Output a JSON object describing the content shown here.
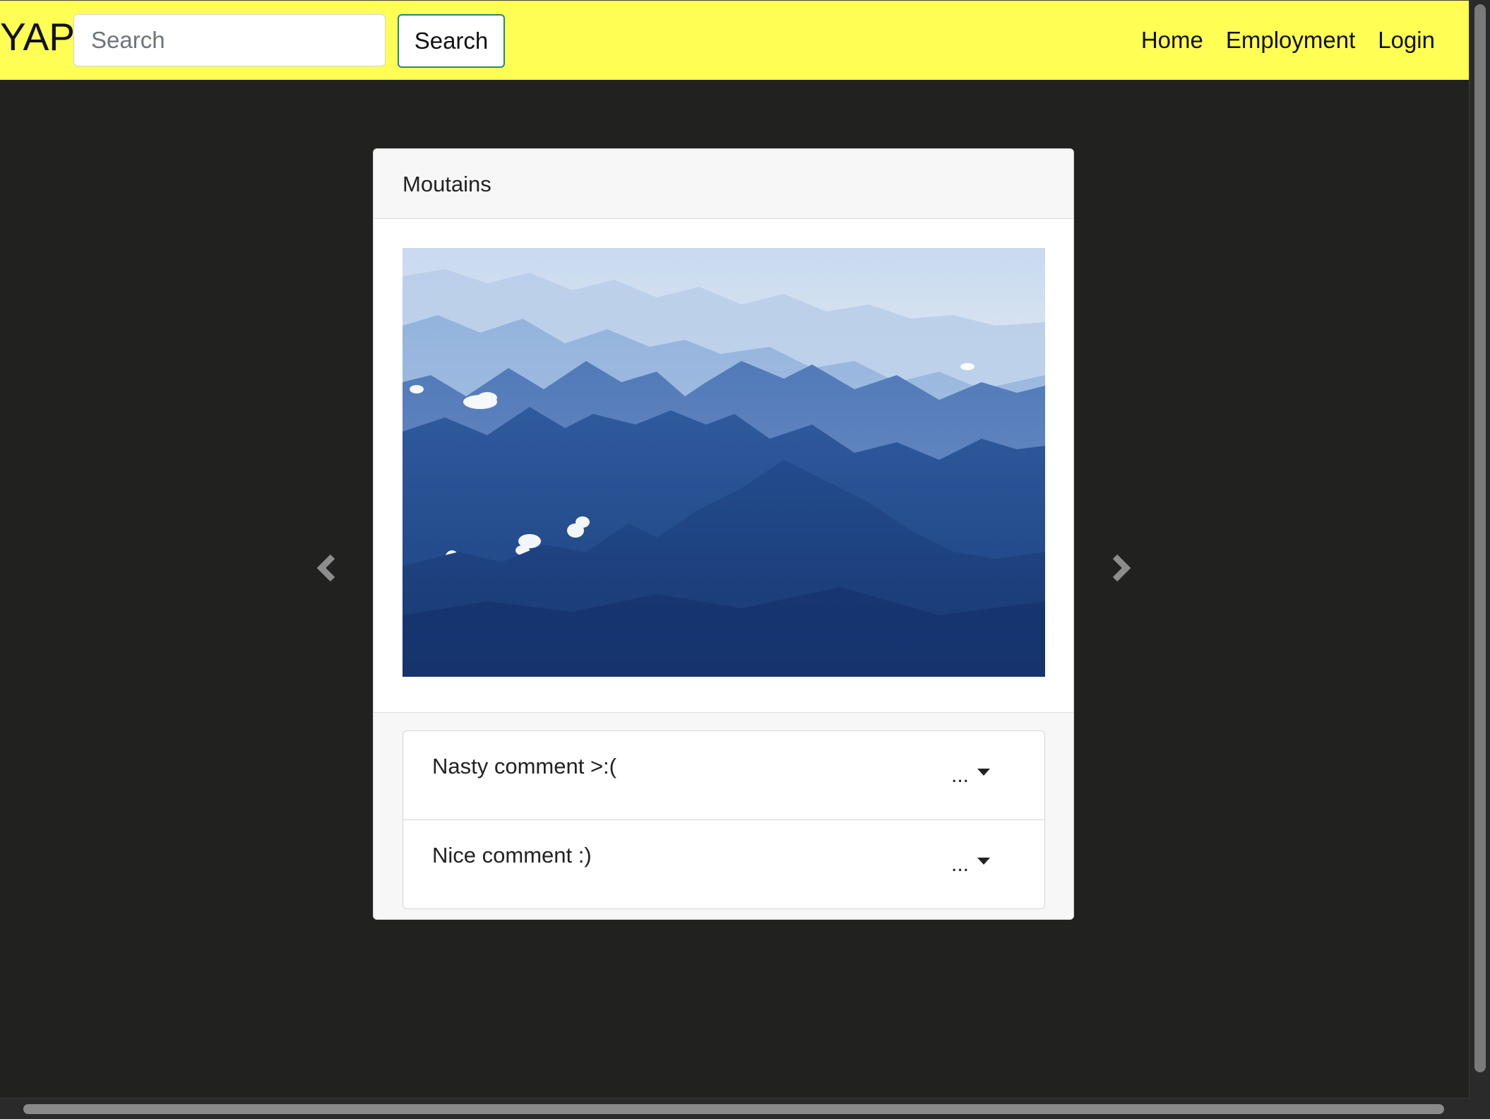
{
  "navbar": {
    "brand": "YAP",
    "search_placeholder": "Search",
    "search_button": "Search",
    "links": [
      "Home",
      "Employment",
      "Login"
    ],
    "background_color": "#fffe55"
  },
  "post": {
    "title": "Moutains",
    "image_icon": "mountain-landscape-image",
    "comments": [
      {
        "text": "Nasty comment >:(",
        "menu_label": "..."
      },
      {
        "text": "Nice comment :)",
        "menu_label": "..."
      }
    ]
  },
  "carousel": {
    "prev_icon": "chevron-left-icon",
    "next_icon": "chevron-right-icon"
  },
  "colors": {
    "page_background": "#212120",
    "card_header": "#f7f7f7",
    "search_button_border": "#1f8a7a"
  }
}
